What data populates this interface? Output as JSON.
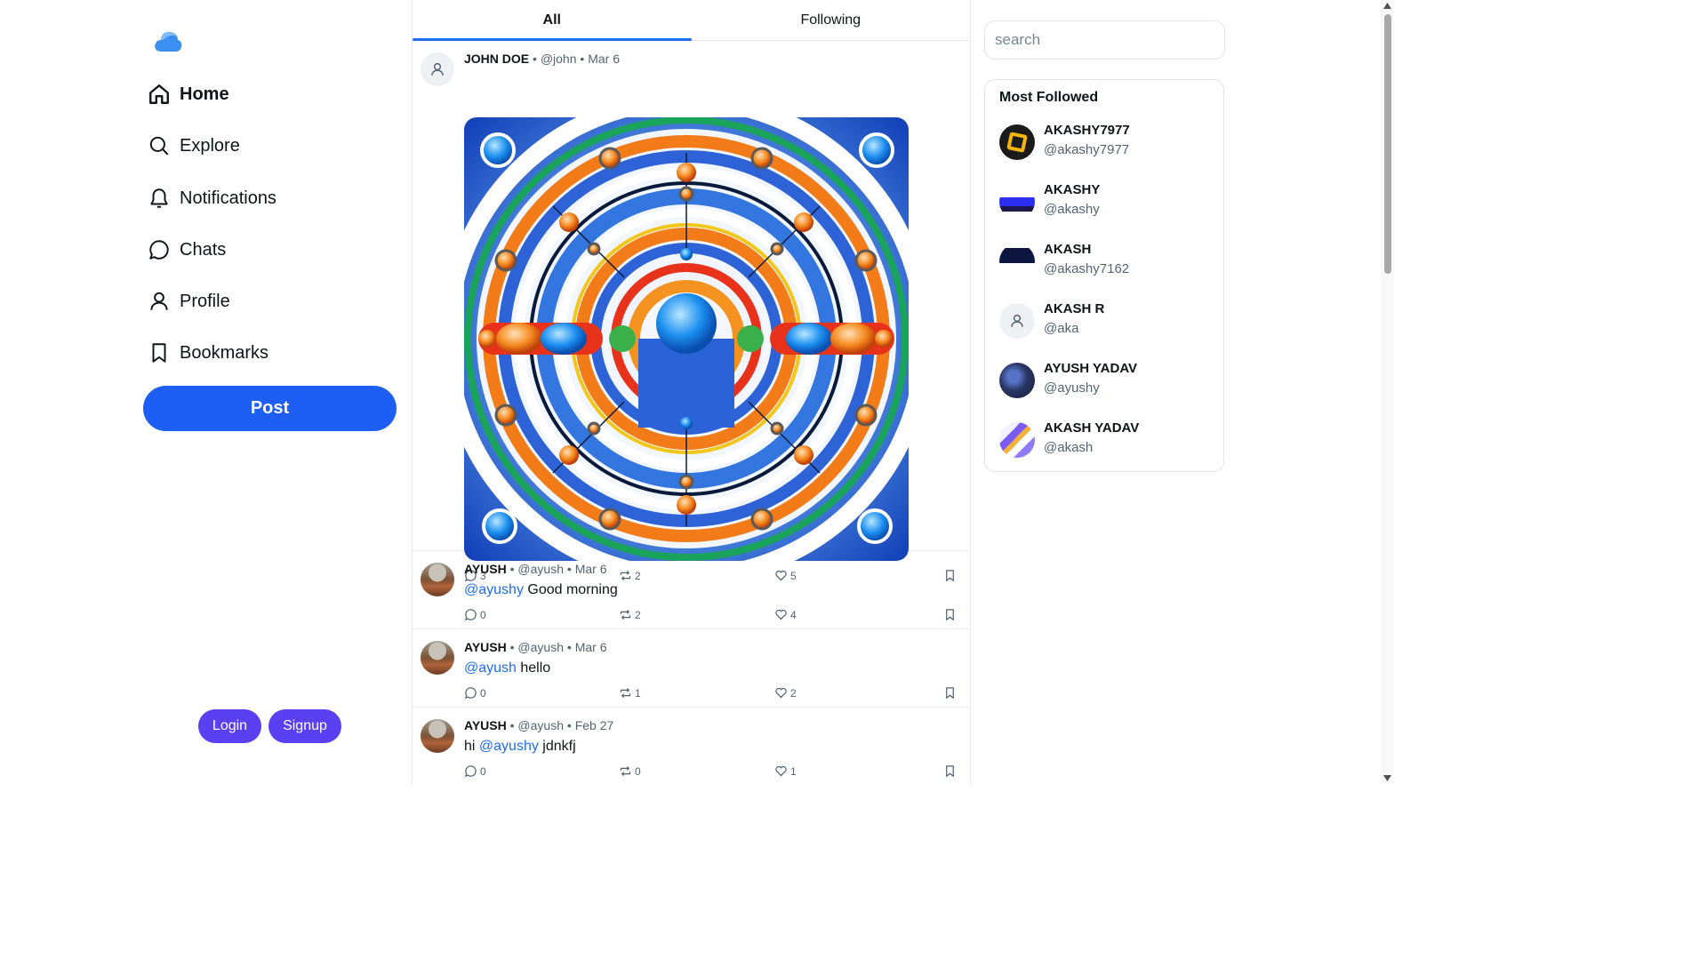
{
  "sidebar": {
    "logo": "cloud-logo",
    "nav": [
      {
        "label": "Home",
        "icon": "home-icon"
      },
      {
        "label": "Explore",
        "icon": "search-icon"
      },
      {
        "label": "Notifications",
        "icon": "bell-icon"
      },
      {
        "label": "Chats",
        "icon": "chat-icon"
      },
      {
        "label": "Profile",
        "icon": "user-icon"
      },
      {
        "label": "Bookmarks",
        "icon": "bookmark-icon"
      }
    ],
    "post_label": "Post",
    "login_label": "Login",
    "signup_label": "Signup"
  },
  "feed": {
    "tabs": [
      {
        "label": "All",
        "active": true
      },
      {
        "label": "Following",
        "active": false
      }
    ],
    "posts": [
      {
        "name": "JOHN DOE",
        "handle": "@john",
        "date": "Mar 6",
        "has_image": true,
        "replies": "3",
        "reposts": "2",
        "likes": "5"
      },
      {
        "name": "AYUSH",
        "handle": "@ayush",
        "date": "Mar 6",
        "text_before": "",
        "mention": "@ayushy",
        "text_after": " Good morning",
        "replies": "0",
        "reposts": "2",
        "likes": "4"
      },
      {
        "name": "AYUSH",
        "handle": "@ayush",
        "date": "Mar 6",
        "text_before": "",
        "mention": "@ayush",
        "text_after": " hello",
        "replies": "0",
        "reposts": "1",
        "likes": "2"
      },
      {
        "name": "AYUSH",
        "handle": "@ayush",
        "date": "Feb 27",
        "text_before": "hi ",
        "mention": "@ayushy",
        "text_after": " jdnkfj",
        "replies": "0",
        "reposts": "0",
        "likes": "1"
      }
    ],
    "separator": "•"
  },
  "right": {
    "search_placeholder": "search",
    "most_followed_title": "Most Followed",
    "users": [
      {
        "name": "AKASHY7977",
        "handle": "@akashy7977"
      },
      {
        "name": "AKASHY",
        "handle": "@akashy"
      },
      {
        "name": "AKASH",
        "handle": "@akashy7162"
      },
      {
        "name": "AKASH R",
        "handle": "@aka"
      },
      {
        "name": "AYUSH YADAV",
        "handle": "@ayushy"
      },
      {
        "name": "AKASH YADAV",
        "handle": "@akash"
      }
    ]
  },
  "colors": {
    "accent": "#1d5ef5",
    "auth_button": "#5b3ff2",
    "mention": "#1d6ef0"
  }
}
